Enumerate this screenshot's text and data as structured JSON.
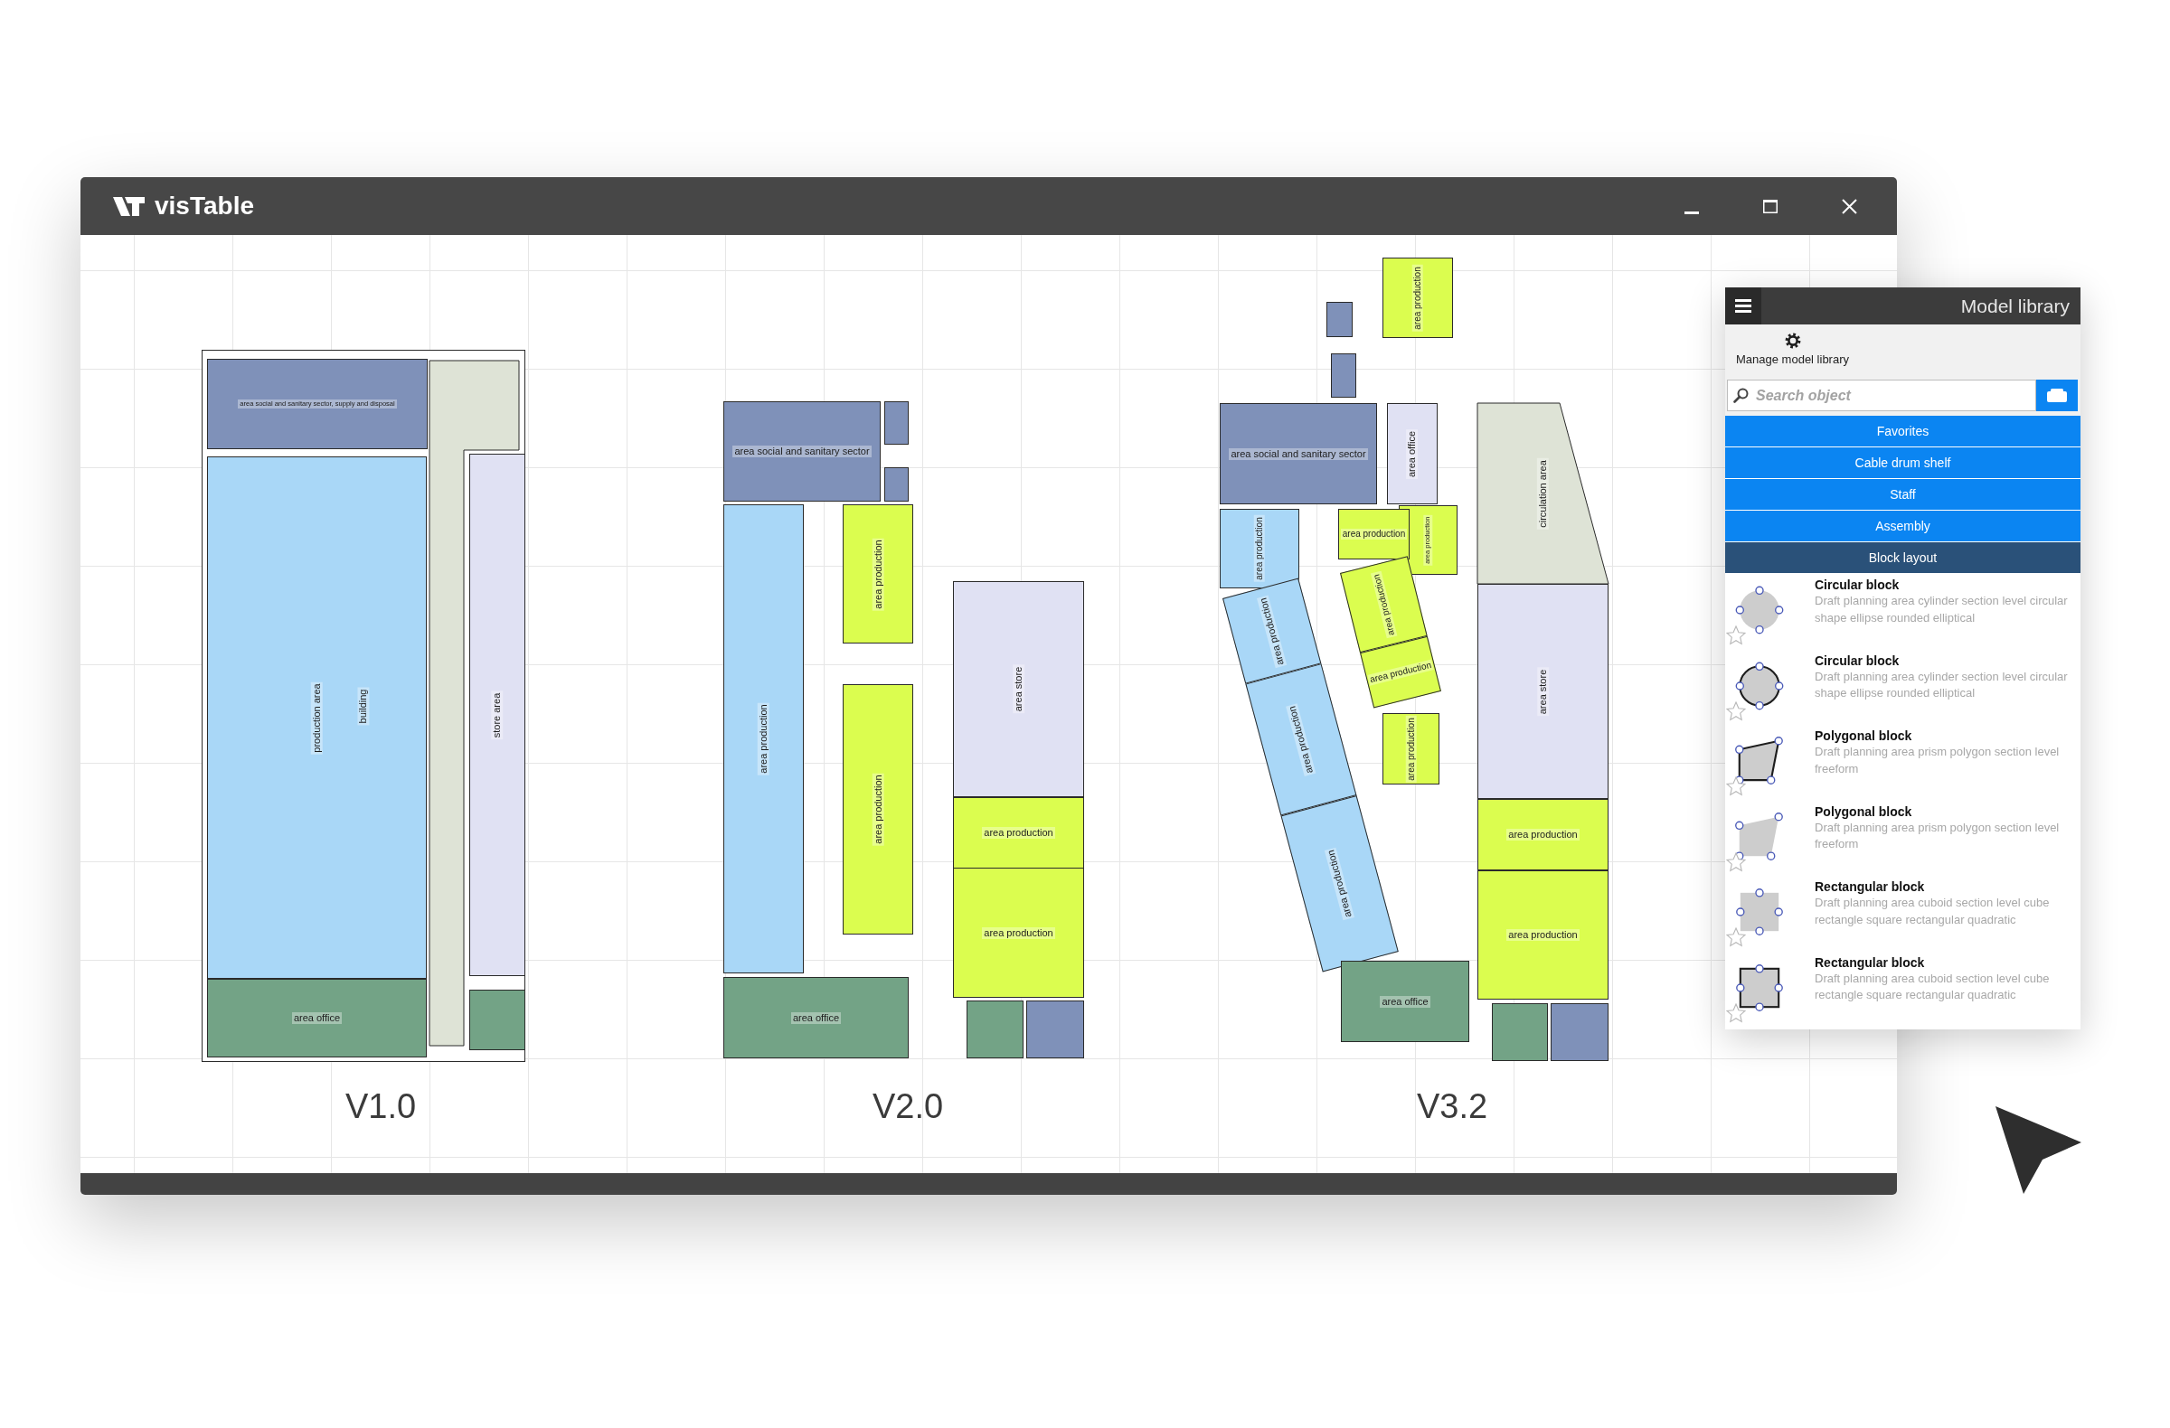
{
  "window": {
    "title": "visTable"
  },
  "layouts": [
    {
      "version": "V1.0",
      "blocks": [
        {
          "kind": "frame",
          "label": "building"
        },
        {
          "kind": "rect",
          "label": "area social and sanitary sector, supply and disposal",
          "color": "#7f91b9"
        },
        {
          "kind": "polygon",
          "color": "#dee3d6"
        },
        {
          "kind": "rect",
          "label": "production area",
          "color": "#a9d7f7"
        },
        {
          "kind": "rect",
          "label": "store area",
          "color": "#e0e1f3"
        },
        {
          "kind": "rect",
          "label": "area office",
          "color": "#73a386"
        },
        {
          "kind": "rect",
          "color": "#73a386"
        }
      ]
    },
    {
      "version": "V2.0",
      "blocks": [
        {
          "kind": "rect",
          "label": "area social and sanitary sector",
          "color": "#7f91b9"
        },
        {
          "kind": "rect",
          "color": "#7f91b9"
        },
        {
          "kind": "rect",
          "color": "#7f91b9"
        },
        {
          "kind": "rect",
          "label": "area production",
          "color": "#a9d7f7"
        },
        {
          "kind": "rect",
          "label": "area production",
          "color": "#dbfd4f"
        },
        {
          "kind": "rect",
          "label": "area production",
          "color": "#dbfd4f"
        },
        {
          "kind": "rect",
          "label": "area store",
          "color": "#e0e1f3"
        },
        {
          "kind": "rect",
          "label": "area production",
          "color": "#dbfd4f"
        },
        {
          "kind": "rect",
          "label": "area production",
          "color": "#dbfd4f"
        },
        {
          "kind": "rect",
          "label": "area office",
          "color": "#73a386"
        },
        {
          "kind": "rect",
          "color": "#73a386"
        },
        {
          "kind": "rect",
          "color": "#7f91b9"
        }
      ]
    },
    {
      "version": "V3.2",
      "blocks": [
        {
          "kind": "rect",
          "label": "area production",
          "color": "#dbfd4f"
        },
        {
          "kind": "rect",
          "color": "#7f91b9"
        },
        {
          "kind": "rect",
          "color": "#7f91b9"
        },
        {
          "kind": "rect",
          "label": "area social and sanitary sector",
          "color": "#7f91b9"
        },
        {
          "kind": "rect",
          "label": "area office",
          "color": "#e0e1f3"
        },
        {
          "kind": "polygon",
          "label": "circulation area",
          "color": "#dee3d6"
        },
        {
          "kind": "rect",
          "label": "area production",
          "color": "#a9d7f7"
        },
        {
          "kind": "rect",
          "label": "area production",
          "color": "#dbfd4f"
        },
        {
          "kind": "rect",
          "label": "area production",
          "color": "#dbfd4f"
        },
        {
          "kind": "rect",
          "label": "area production",
          "color": "#a9d7f7"
        },
        {
          "kind": "rect",
          "label": "area production",
          "color": "#a9d7f7"
        },
        {
          "kind": "rect",
          "label": "area production",
          "color": "#a9d7f7"
        },
        {
          "kind": "rect",
          "label": "area production",
          "color": "#dbfd4f"
        },
        {
          "kind": "rect",
          "label": "area production",
          "color": "#dbfd4f"
        },
        {
          "kind": "rect",
          "label": "area production",
          "color": "#dbfd4f"
        },
        {
          "kind": "rect",
          "label": "area store",
          "color": "#e0e1f3"
        },
        {
          "kind": "rect",
          "label": "area production",
          "color": "#dbfd4f"
        },
        {
          "kind": "rect",
          "label": "area production",
          "color": "#dbfd4f"
        },
        {
          "kind": "rect",
          "label": "area office",
          "color": "#73a386"
        },
        {
          "kind": "rect",
          "color": "#73a386"
        },
        {
          "kind": "rect",
          "color": "#7f91b9"
        }
      ]
    }
  ],
  "model_library": {
    "title": "Model library",
    "manage_label": "Manage model library",
    "search": {
      "placeholder": "Search object"
    },
    "categories": [
      {
        "label": "Favorites",
        "selected": false
      },
      {
        "label": "Cable drum shelf",
        "selected": false
      },
      {
        "label": "Staff",
        "selected": false
      },
      {
        "label": "Assembly",
        "selected": false
      },
      {
        "label": "Block layout",
        "selected": true
      }
    ],
    "items": [
      {
        "title": "Circular block",
        "description": "Draft planning area cylinder section level circular shape ellipse rounded elliptical",
        "kind": "circle",
        "outlined": false,
        "favorite": false
      },
      {
        "title": "Circular block",
        "description": "Draft planning area cylinder section level circular shape ellipse rounded elliptical",
        "kind": "circle",
        "outlined": true,
        "favorite": false
      },
      {
        "title": "Polygonal block",
        "description": "Draft planning area prism polygon section level freeform",
        "kind": "polygon",
        "outlined": true,
        "favorite": false
      },
      {
        "title": "Polygonal block",
        "description": "Draft planning area prism polygon section level freeform",
        "kind": "polygon",
        "outlined": false,
        "favorite": false
      },
      {
        "title": "Rectangular block",
        "description": "Draft planning area cuboid section level cube rectangle square rectangular quadratic",
        "kind": "rectangle",
        "outlined": false,
        "favorite": false
      },
      {
        "title": "Rectangular block",
        "description": "Draft planning area cuboid section level cube rectangle square rectangular quadratic",
        "kind": "rectangle",
        "outlined": true,
        "favorite": false
      }
    ]
  }
}
